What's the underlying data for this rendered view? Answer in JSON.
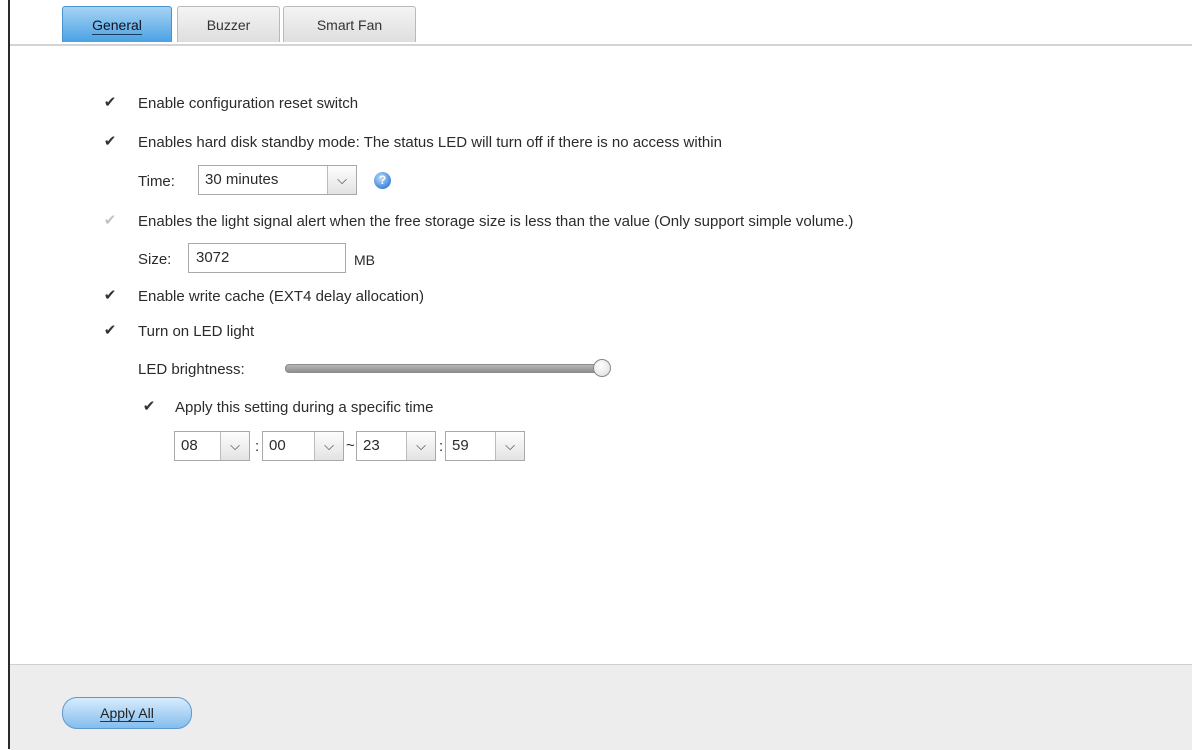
{
  "tabs": [
    {
      "label": "General",
      "active": true
    },
    {
      "label": "Buzzer",
      "active": false
    },
    {
      "label": "Smart Fan",
      "active": false
    }
  ],
  "settings": {
    "reset_switch": {
      "label": "Enable configuration reset switch",
      "checked": true
    },
    "hdd_standby": {
      "label": "Enables hard disk standby mode: The status LED will turn off if there is no access within",
      "checked": true,
      "time_label": "Time:",
      "time_value": "30 minutes",
      "help_icon": "question-circle-icon"
    },
    "storage_alert": {
      "label": "Enables the light signal alert when the free storage size is less than the value (Only support simple volume.)",
      "checked": true,
      "disabled": true,
      "size_label": "Size:",
      "size_value": "3072",
      "size_unit": "MB"
    },
    "write_cache": {
      "label": "Enable write cache (EXT4 delay allocation)",
      "checked": true
    },
    "led_light": {
      "label": "Turn on LED light",
      "checked": true,
      "brightness_label": "LED brightness:",
      "brightness_level": 1.0,
      "schedule": {
        "label": "Apply this setting during a specific time",
        "checked": true,
        "start_hour": "08",
        "start_minute": "00",
        "end_hour": "23",
        "end_minute": "59",
        "colon": ":",
        "range_separator": "~"
      }
    }
  },
  "footer": {
    "apply_all_label": "Apply All"
  },
  "colors": {
    "active_tab": "#4aa2e4",
    "button": "#84bdee",
    "footer_bg": "#ededed"
  }
}
